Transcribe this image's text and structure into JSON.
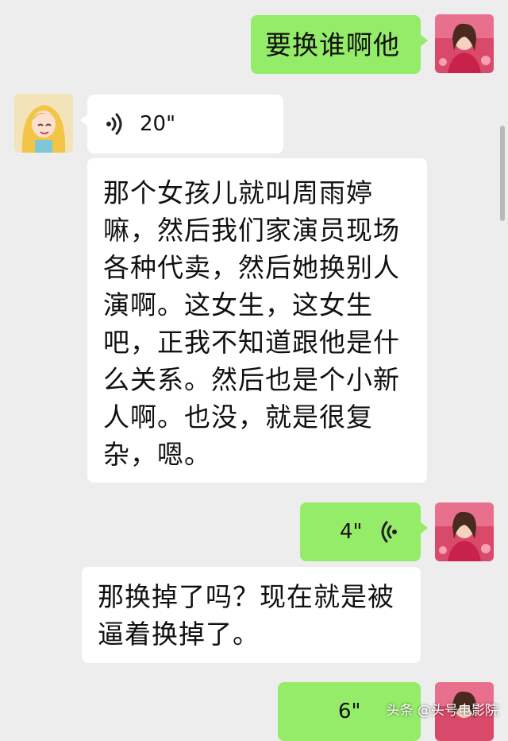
{
  "messages": [
    {
      "id": "m1",
      "side": "right",
      "type": "text",
      "text": "要换谁啊他"
    },
    {
      "id": "m2",
      "side": "left",
      "type": "voice",
      "duration": "20\""
    },
    {
      "id": "m3",
      "side": "left",
      "type": "text",
      "lines": [
        "那个女孩儿就叫周雨婷",
        "嘛，然后我们家演员现场",
        "各种代卖，然后她换别人",
        "演啊。这女生，这女生",
        "吧，正我不知道跟他是什",
        "么关系。然后也是个小新",
        "人啊。也没，就是很复",
        "杂，嗯。"
      ]
    },
    {
      "id": "m4",
      "side": "right",
      "type": "voice",
      "duration": "4\""
    },
    {
      "id": "m5",
      "side": "left",
      "type": "text",
      "lines": [
        "那换掉了吗？现在就是被",
        "逼着换掉了。"
      ]
    },
    {
      "id": "m6",
      "side": "right",
      "type": "voice",
      "duration": "6\""
    }
  ],
  "icons": {
    "voice_left": "voice-wave-icon",
    "voice_right": "voice-wave-icon"
  },
  "watermark": "头条 @头号电影院",
  "colors": {
    "background": "#ededed",
    "sent_bubble": "#95ec69",
    "received_bubble": "#ffffff"
  }
}
